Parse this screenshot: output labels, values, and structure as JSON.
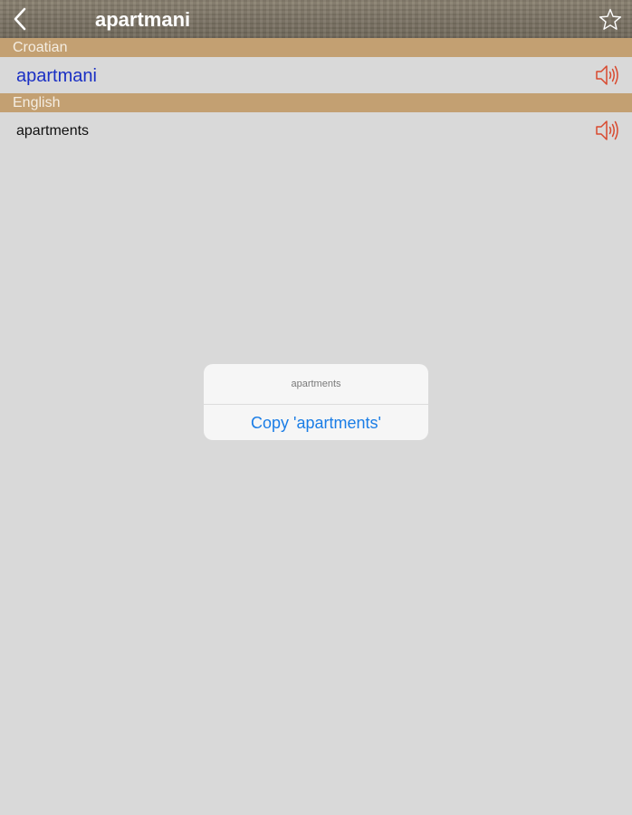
{
  "header": {
    "title": "apartmani",
    "back_icon": "chevron-left-icon",
    "favorite_icon": "star-outline-icon"
  },
  "source": {
    "language_label": "Croatian",
    "word": "apartmani",
    "speaker_icon": "speaker-icon"
  },
  "target": {
    "language_label": "English",
    "word": "apartments",
    "speaker_icon": "speaker-icon"
  },
  "dialog": {
    "title": "apartments",
    "action_label": "Copy 'apartments'"
  },
  "colors": {
    "background": "#d9d9d9",
    "section_header": "#c3a072",
    "source_word": "#1a2fc4",
    "speaker": "#d9492e",
    "dialog_action": "#1a7de6"
  }
}
